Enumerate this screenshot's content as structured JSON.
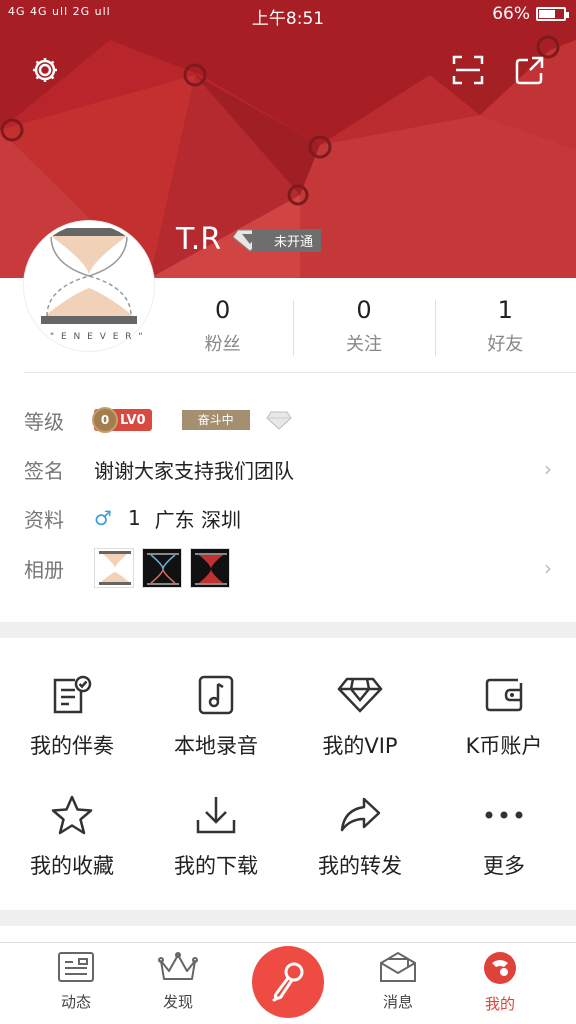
{
  "status_bar": {
    "signal": "4G 4G ull 2G ull",
    "time": "上午8:51",
    "battery": "66%",
    "battery_level": 0.66
  },
  "header": {
    "settings_icon": "gear-icon",
    "scan_icon": "scan-icon",
    "share_icon": "share-icon",
    "username": "T.R",
    "vip_status": "未开通",
    "colors": {
      "banner": "#b8262b",
      "accent": "#ee4b42"
    }
  },
  "avatar": {
    "caption": "\" E  N E V E R \""
  },
  "stats": [
    {
      "value": "0",
      "label": "粉丝"
    },
    {
      "value": "0",
      "label": "关注"
    },
    {
      "value": "1",
      "label": "好友"
    }
  ],
  "profile": {
    "level_label": "等级",
    "level_badge": "LV0",
    "level_coin": "0",
    "level_status": "奋斗中",
    "signature_label": "签名",
    "signature": "谢谢大家支持我们团队",
    "info_label": "资料",
    "gender_symbol": "♂",
    "age": "1",
    "location": "广东 深圳",
    "album_label": "相册"
  },
  "features": [
    {
      "label": "我的伴奏",
      "icon": "accompaniment-icon"
    },
    {
      "label": "本地录音",
      "icon": "local-recording-icon"
    },
    {
      "label": "我的VIP",
      "icon": "vip-diamond-icon"
    },
    {
      "label": "K币账户",
      "icon": "wallet-icon"
    },
    {
      "label": "我的收藏",
      "icon": "star-icon"
    },
    {
      "label": "我的下载",
      "icon": "download-icon"
    },
    {
      "label": "我的转发",
      "icon": "forward-icon"
    },
    {
      "label": "更多",
      "icon": "more-icon"
    }
  ],
  "bottom_nav": [
    {
      "label": "动态",
      "icon": "feed-icon"
    },
    {
      "label": "发现",
      "icon": "crown-icon"
    },
    {
      "label": "消息",
      "icon": "message-icon"
    },
    {
      "label": "我的",
      "icon": "me-icon",
      "active": true
    }
  ]
}
